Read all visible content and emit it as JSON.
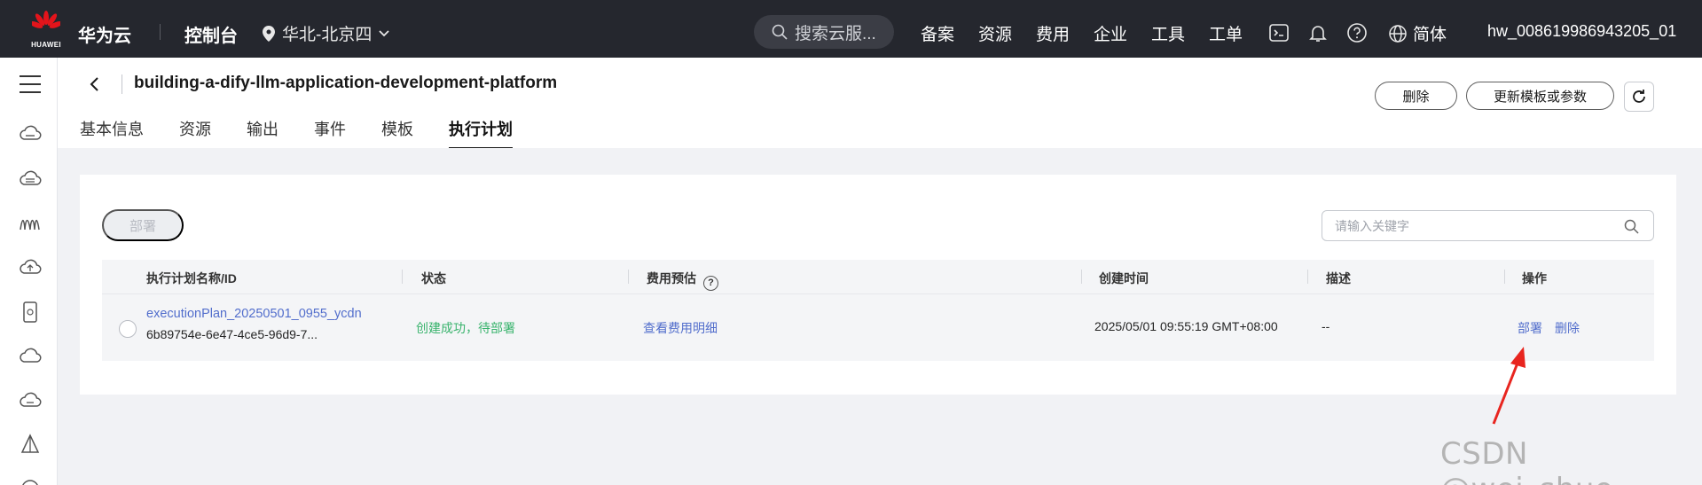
{
  "topbar": {
    "brand_word": "HUAWEI",
    "cloud_name": "华为云",
    "console": "控制台",
    "region": "华北-北京四",
    "search_placeholder": "搜索云服...",
    "nav": [
      "备案",
      "资源",
      "费用",
      "企业",
      "工具",
      "工单"
    ],
    "language": "简体",
    "username": "hw_008619986943205_01",
    "colors": {
      "background": "#25272e",
      "brand_red": "#e3141b"
    }
  },
  "header": {
    "title": "building-a-dify-llm-application-development-platform",
    "delete_label": "删除",
    "update_label": "更新模板或参数"
  },
  "tabs": {
    "items": [
      "基本信息",
      "资源",
      "输出",
      "事件",
      "模板",
      "执行计划"
    ],
    "active": "执行计划"
  },
  "toolbar": {
    "deploy_label": "部署",
    "search_placeholder": "请输入关键字"
  },
  "table": {
    "columns": {
      "name": "执行计划名称/ID",
      "status": "状态",
      "cost": "费用预估",
      "created": "创建时间",
      "desc": "描述",
      "actions": "操作"
    },
    "rows": [
      {
        "name": "executionPlan_20250501_0955_ycdn",
        "id": "6b89754e-6e47-4ce5-96d9-7...",
        "status": "创建成功，待部署",
        "cost_link": "查看费用明细",
        "created": "2025/05/01 09:55:19 GMT+08:00",
        "desc": "--",
        "action_deploy": "部署",
        "action_delete": "删除"
      }
    ]
  },
  "colors": {
    "link": "#526ecc",
    "success": "#38b36c",
    "annotation": "#e8251f"
  },
  "watermark": "CSDN @wei_shuo"
}
